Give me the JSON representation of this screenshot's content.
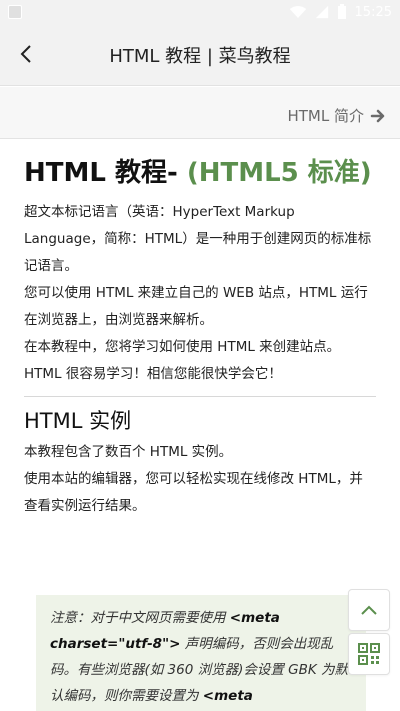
{
  "status": {
    "time": "15:25"
  },
  "header": {
    "title": "HTML 教程 | 菜鸟教程"
  },
  "nav": {
    "next_label": "HTML 简介"
  },
  "article": {
    "title_main": "HTML 教程- ",
    "title_accent": "(HTML5 标准)",
    "p1": "超文本标记语言（英语：HyperText Markup Language，简称：HTML）是一种用于创建网页的标准标记语言。",
    "p2": "您可以使用 HTML 来建立自己的 WEB 站点，HTML 运行在浏览器上，由浏览器来解析。",
    "p3": "在本教程中，您将学习如何使用 HTML 来创建站点。",
    "p4": "HTML 很容易学习！相信您能很快学会它！",
    "section_title": "HTML 实例",
    "s1": "本教程包含了数百个 HTML 实例。",
    "s2": "使用本站的编辑器，您可以轻松实现在线修改 HTML，并查看实例运行结果。",
    "note_prefix": "注意：对于中文网页需要使用 ",
    "note_code1": "<meta charset=\"utf-8\">",
    "note_mid": " 声明编码，否则会出现乱码。有些浏览器(如 360 浏览器)会设置 GBK 为默认编码，则你需要设置为 ",
    "note_code2": "<meta charset=\"gbk\">",
    "note_suffix": "。"
  },
  "colors": {
    "accent": "#5b8f4d",
    "note_bg": "#eef3e8",
    "nav_arrow": "#6a6a6a"
  }
}
